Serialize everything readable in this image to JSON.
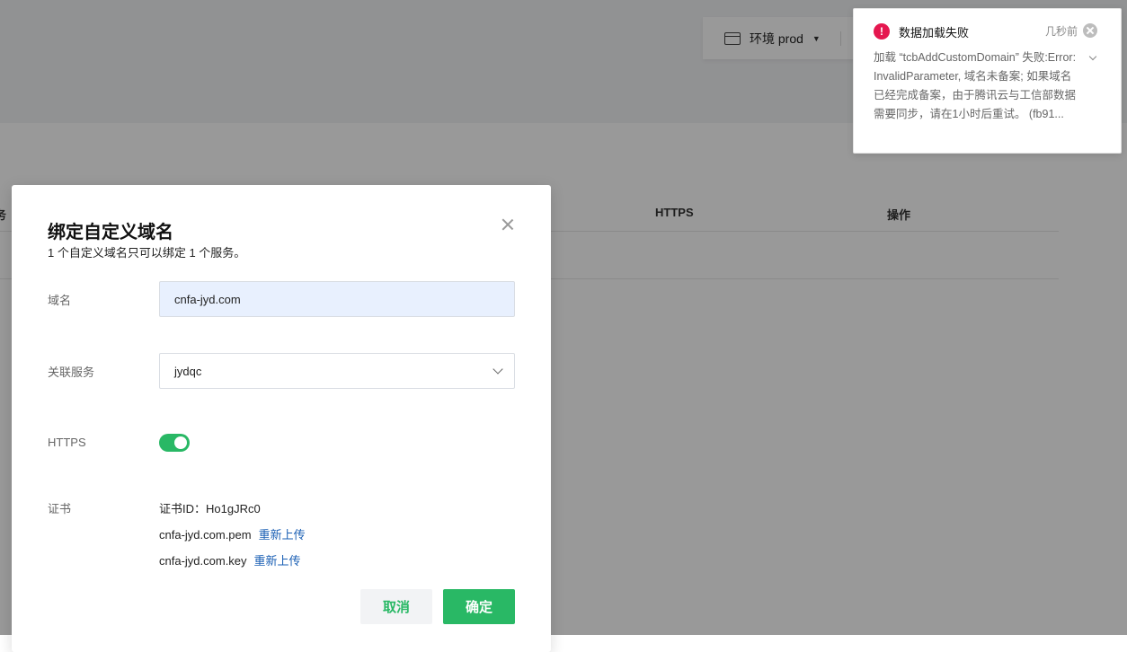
{
  "background": {
    "env_label": "环境 prod",
    "table_headers": [
      "务",
      "HTTPS",
      "操作"
    ]
  },
  "modal": {
    "title": "绑定自定义域名",
    "subtitle": "1 个自定义域名只可以绑定 1 个服务。",
    "domain_label": "域名",
    "domain_value": "cnfa-jyd.com",
    "service_label": "关联服务",
    "service_value": "jydqc",
    "https_label": "HTTPS",
    "https_enabled": true,
    "cert_label": "证书",
    "cert_id": "证书ID：Ho1gJRc0",
    "cert_pem": "cnfa-jyd.com.pem",
    "cert_key": "cnfa-jyd.com.key",
    "reupload": "重新上传",
    "cancel": "取消",
    "confirm": "确定"
  },
  "notification": {
    "title": "数据加载失败",
    "time": "几秒前",
    "body": "加载 “tcbAddCustomDomain” 失败:Error: InvalidParameter, 域名未备案; 如果域名已经完成备案，由于腾讯云与工信部数据需要同步，请在1小时后重试。 (fb91...",
    "accent": "#e5174f"
  },
  "colors": {
    "primary": "#29b865",
    "link": "#1a5fb4"
  }
}
